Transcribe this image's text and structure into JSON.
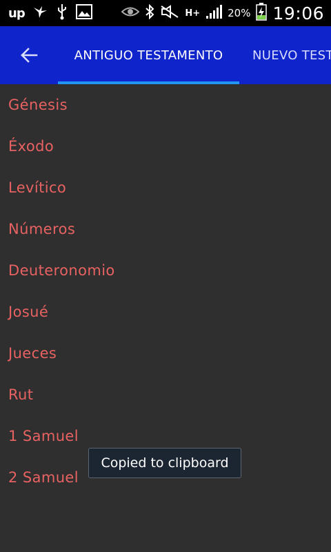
{
  "status_bar": {
    "app_icon_text": "up",
    "battery_percent": "20%",
    "network_label": "H+",
    "time": "19:06"
  },
  "header": {
    "tabs": [
      {
        "label": "ANTIGUO TESTAMENTO",
        "selected": true
      },
      {
        "label": "NUEVO TESTAMENTO",
        "selected": false
      }
    ]
  },
  "books": [
    "Génesis",
    "Éxodo",
    "Levítico",
    "Números",
    "Deuteronomio",
    "Josué",
    "Jueces",
    "Rut",
    "1 Samuel",
    "2 Samuel"
  ],
  "toast": {
    "message": "Copied to clipboard"
  },
  "colors": {
    "app_bar": "#1024cc",
    "tab_indicator": "#2196f3",
    "book_text": "#e86262",
    "background": "#2f2f2f"
  }
}
